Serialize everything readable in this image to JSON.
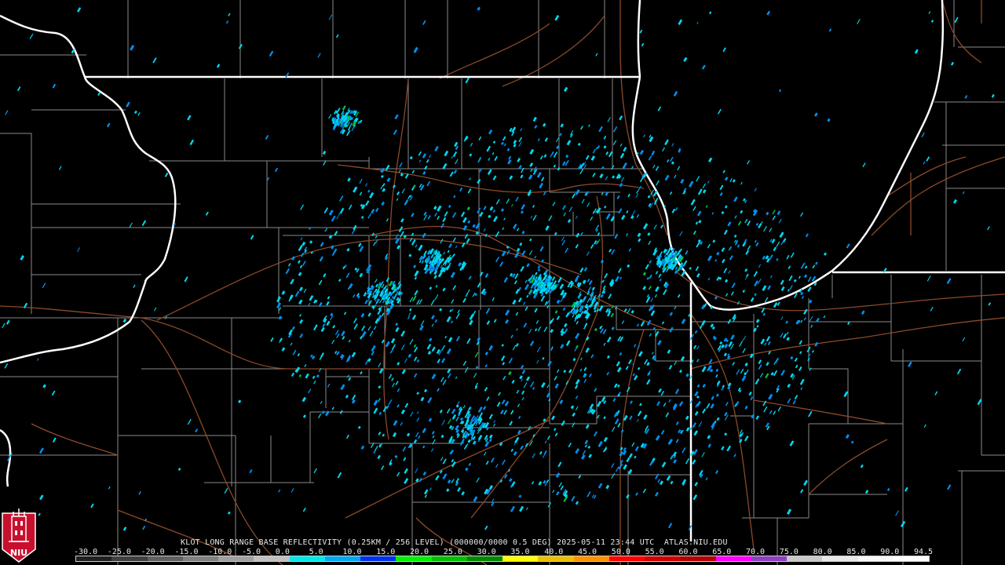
{
  "product": {
    "title": "KLOT LONG RANGE BASE REFLECTIVITY (0.25KM / 256 LEVEL) (000000/0000 0.5 DEG) 2025-05-11 23:44 UTC  ATLAS.NIU.EDU"
  },
  "logo": {
    "text": "NIU"
  },
  "scale": {
    "labels": [
      "-30.0",
      "-25.0",
      "-20.0",
      "-15.0",
      "-10.0",
      "-5.0",
      "0.0",
      "5.0",
      "10.0",
      "15.0",
      "20.0",
      "25.0",
      "30.0",
      "35.0",
      "40.0",
      "45.0",
      "50.0",
      "55.0",
      "60.0",
      "65.0",
      "70.0",
      "75.0",
      "80.0",
      "85.0",
      "90.0",
      "94.5"
    ],
    "colors": [
      "#202020",
      "#404040",
      "#606060",
      "#808080",
      "#a0a0a0",
      "#c0c0c0",
      "#00e8e8",
      "#00a8f0",
      "#0030f0",
      "#00f000",
      "#00c000",
      "#008800",
      "#ffff00",
      "#e8c000",
      "#ff9000",
      "#ff0000",
      "#d00000",
      "#b00000",
      "#ff00ff",
      "#9040c0",
      "#c8c8c8",
      "#e8e8e8",
      "#f8f8f8",
      "#ffffff"
    ]
  },
  "colors": {
    "background": "#000000",
    "state_border": "#ffffff",
    "county_line": "#8a8a8a",
    "highway": "#8b4a2a",
    "echo_light": "#00d8f0",
    "echo_mid": "#0090f0",
    "echo_strong": "#00c040"
  }
}
